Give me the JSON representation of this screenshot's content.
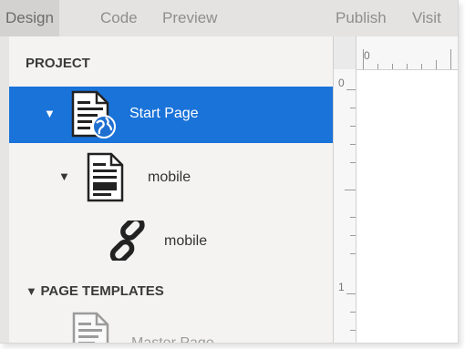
{
  "tabs": [
    "Design",
    "Code",
    "Preview",
    "Publish",
    "Visit"
  ],
  "project": {
    "header": "PROJECT",
    "items": [
      {
        "label": "Start Page",
        "icon": "web-page-icon",
        "selected": true,
        "expanded": true
      },
      {
        "label": "mobile",
        "icon": "mobile-page-icon",
        "selected": false,
        "expanded": true
      },
      {
        "label": "mobile",
        "icon": "link-icon",
        "selected": false
      }
    ]
  },
  "templates": {
    "header": "PAGE TEMPLATES",
    "items": [
      {
        "label": "Master Page",
        "icon": "page-template-icon"
      }
    ]
  },
  "disclosure_glyph": "▼",
  "ruler": {
    "h_label": "0",
    "v_labels": [
      "0",
      "1"
    ]
  },
  "colors": {
    "selection": "#1a73d9",
    "sidebar_bg": "#f4f3f2",
    "tabbar_bg": "#e4e3e2"
  }
}
